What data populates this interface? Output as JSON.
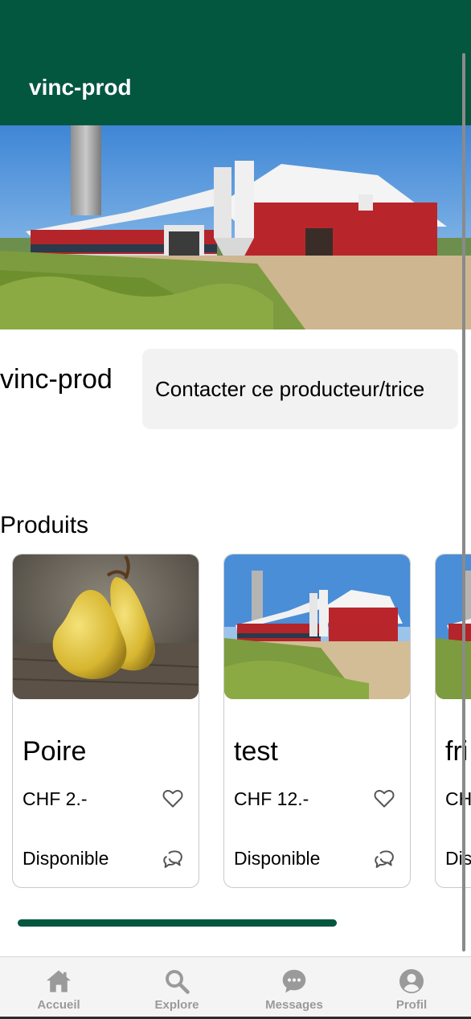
{
  "header": {
    "title": "vinc-prod"
  },
  "profile": {
    "name": "vinc-prod",
    "contact_label": "Contacter ce producteur/trice"
  },
  "products_section": {
    "title": "Produits"
  },
  "products": [
    {
      "name": "Poire",
      "price": "CHF 2.-",
      "status": "Disponible",
      "image": "pears",
      "favorite": false
    },
    {
      "name": "test",
      "price": "CHF 12.-",
      "status": "Disponible",
      "image": "farm",
      "favorite": false
    },
    {
      "name": "fri",
      "price": "CHF",
      "status": "Dis",
      "image": "farm",
      "favorite": false
    }
  ],
  "tabbar": {
    "tabs": [
      {
        "label": "Accueil",
        "icon": "home-icon"
      },
      {
        "label": "Explore",
        "icon": "search-icon"
      },
      {
        "label": "Messages",
        "icon": "chat-bubble-icon"
      },
      {
        "label": "Profil",
        "icon": "user-icon"
      }
    ]
  },
  "colors": {
    "brand": "#03573f",
    "tab_inactive": "#9a9a9a"
  }
}
